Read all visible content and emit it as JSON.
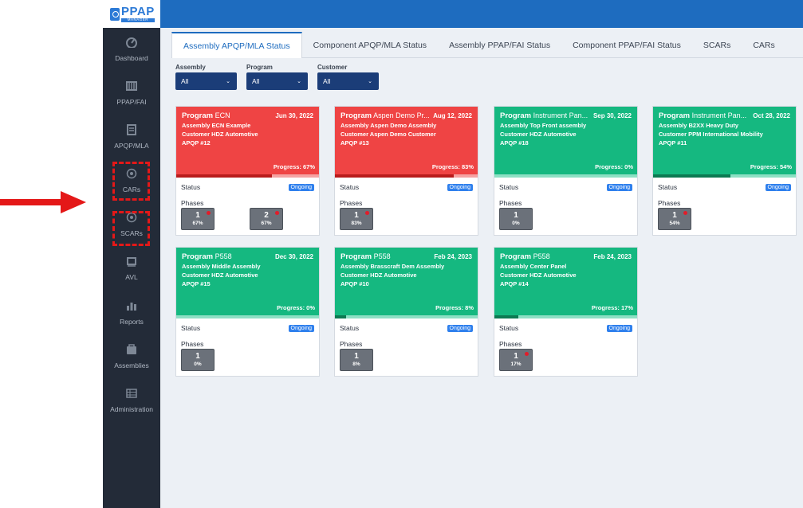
{
  "logo": {
    "main": "PPAP",
    "sub": "MANAGER"
  },
  "sidebar": {
    "items": [
      {
        "label": "Dashboard",
        "icon": "dashboard-icon"
      },
      {
        "label": "PPAP/FAI",
        "icon": "ppap-icon"
      },
      {
        "label": "APQP/MLA",
        "icon": "apqp-icon"
      },
      {
        "label": "CARs",
        "icon": "cars-icon"
      },
      {
        "label": "SCARs",
        "icon": "scars-icon"
      },
      {
        "label": "AVL",
        "icon": "avl-icon"
      },
      {
        "label": "Reports",
        "icon": "bar-chart-icon"
      },
      {
        "label": "Assemblies",
        "icon": "assemblies-icon"
      },
      {
        "label": "Administration",
        "icon": "table-icon"
      }
    ]
  },
  "tabs": [
    {
      "label": "Assembly APQP/MLA Status",
      "active": true
    },
    {
      "label": "Component APQP/MLA Status",
      "active": false
    },
    {
      "label": "Assembly PPAP/FAI Status",
      "active": false
    },
    {
      "label": "Component PPAP/FAI Status",
      "active": false
    },
    {
      "label": "SCARs",
      "active": false
    },
    {
      "label": "CARs",
      "active": false
    }
  ],
  "filters": [
    {
      "label": "Assembly",
      "value": "All"
    },
    {
      "label": "Program",
      "value": "All"
    },
    {
      "label": "Customer",
      "value": "All"
    }
  ],
  "common": {
    "program_prefix": "Program",
    "status_label": "Status",
    "phases_label": "Phases"
  },
  "colors": {
    "red": "#ef4444",
    "green": "#15b880",
    "nav_bg": "#232b38",
    "topbar": "#1e6cbf",
    "badge": "#2f80ed"
  },
  "cards": [
    {
      "color": "red",
      "program": "ECN",
      "date": "Jun 30, 2022",
      "assembly": "Assembly ECN Example",
      "customer": "Customer HDZ Automotive",
      "apqp": "APQP #12",
      "progress_text": "Progress: 67%",
      "progress": 0.67,
      "status": "Ongoing",
      "phases": [
        {
          "num": "1",
          "pct": "67%",
          "flag": true
        },
        {
          "num": "2",
          "pct": "67%",
          "flag": true
        }
      ]
    },
    {
      "color": "red",
      "program": "Aspen Demo Pr...",
      "date": "Aug 12, 2022",
      "assembly": "Assembly Aspen Demo Assembly",
      "customer": "Customer Aspen Demo Customer",
      "apqp": "APQP #13",
      "progress_text": "Progress: 83%",
      "progress": 0.83,
      "status": "Ongoing",
      "phases": [
        {
          "num": "1",
          "pct": "83%",
          "flag": true
        }
      ]
    },
    {
      "color": "green",
      "program": "Instrument Pan...",
      "date": "Sep 30, 2022",
      "assembly": "Assembly Top Front assembly",
      "customer": "Customer HDZ Automotive",
      "apqp": "APQP #18",
      "progress_text": "Progress: 0%",
      "progress": 0.0,
      "status": "Ongoing",
      "phases": [
        {
          "num": "1",
          "pct": "0%",
          "flag": false
        }
      ]
    },
    {
      "color": "green",
      "program": "Instrument Pan...",
      "date": "Oct 28, 2022",
      "assembly": "Assembly B2XX Heavy Duty",
      "customer": "Customer PPM International Mobility",
      "apqp": "APQP #11",
      "progress_text": "Progress: 54%",
      "progress": 0.54,
      "status": "Ongoing",
      "phases": [
        {
          "num": "1",
          "pct": "54%",
          "flag": true
        }
      ]
    },
    {
      "color": "green",
      "program": "P558",
      "date": "Dec 30, 2022",
      "assembly": "Assembly Middle Assembly",
      "customer": "Customer HDZ Automotive",
      "apqp": "APQP #15",
      "progress_text": "Progress: 0%",
      "progress": 0.0,
      "status": "Ongoing",
      "phases": [
        {
          "num": "1",
          "pct": "0%",
          "flag": false
        }
      ]
    },
    {
      "color": "green",
      "program": "P558",
      "date": "Feb 24, 2023",
      "assembly": "Assembly Brasscraft Dem Assembly",
      "customer": "Customer HDZ Automotive",
      "apqp": "APQP #10",
      "progress_text": "Progress: 8%",
      "progress": 0.08,
      "status": "Ongoing",
      "phases": [
        {
          "num": "1",
          "pct": "8%",
          "flag": false
        }
      ]
    },
    {
      "color": "green",
      "program": "P558",
      "date": "Feb 24, 2023",
      "assembly": "Assembly Center Panel",
      "customer": "Customer HDZ Automotive",
      "apqp": "APQP #14",
      "progress_text": "Progress: 17%",
      "progress": 0.17,
      "status": "Ongoing",
      "phases": [
        {
          "num": "1",
          "pct": "17%",
          "flag": true
        }
      ]
    }
  ]
}
